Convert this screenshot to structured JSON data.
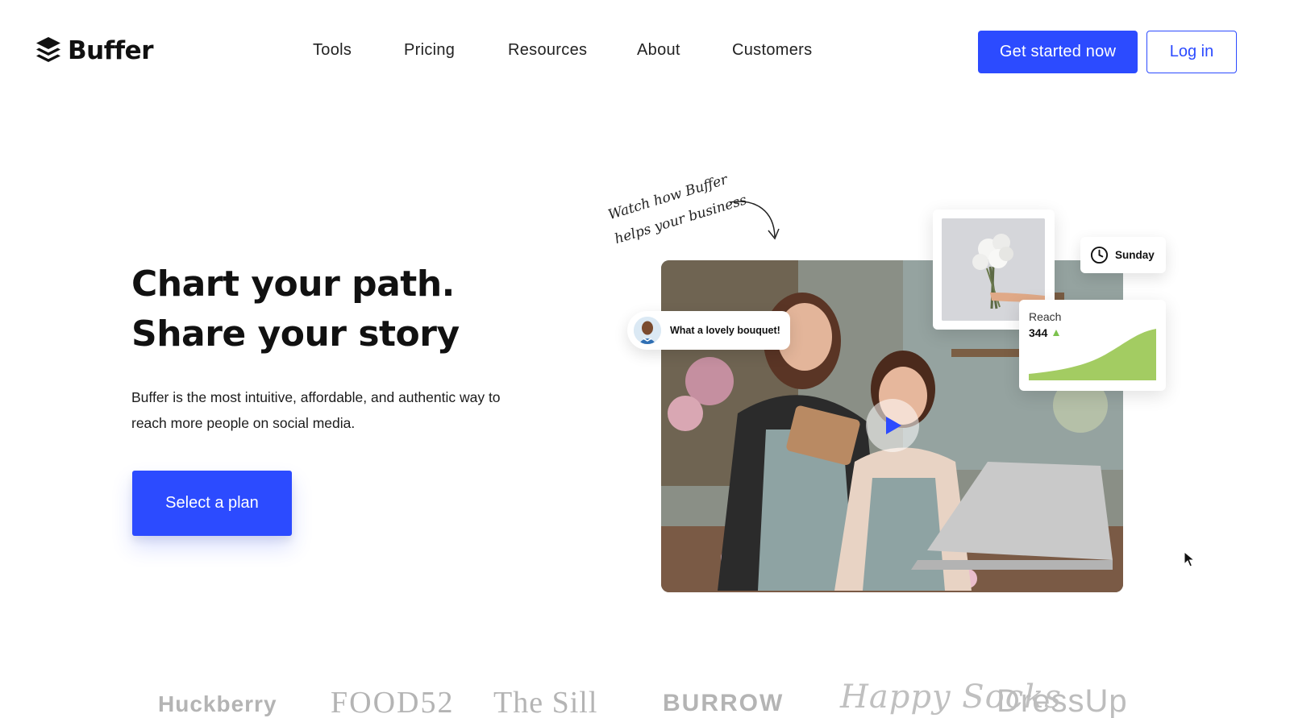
{
  "header": {
    "logo_text": "Buffer",
    "nav": [
      "Tools",
      "Pricing",
      "Resources",
      "About",
      "Customers"
    ],
    "cta_label": "Get started now",
    "login_label": "Log in"
  },
  "hero": {
    "headline_1": "Chart your path.",
    "headline_2": "Share your story",
    "subtext": "Buffer is the most intuitive, affordable, and authentic way to reach more people on social media.",
    "cta_label": "Select a plan"
  },
  "visual": {
    "annotation_1": "Watch how Buffer",
    "annotation_2": "helps your business",
    "comment": "What a lovely bouquet!",
    "day": "Sunday",
    "reach_label": "Reach",
    "reach_value": "344",
    "reach_trend": "up"
  },
  "brands": [
    "Huckberry",
    "FOOD52",
    "The Sill",
    "BURROW",
    "Happy Socks",
    "DressUp"
  ],
  "colors": {
    "brand_blue": "#2c4bff",
    "reach_green": "#a3cc62",
    "text_dark": "#111111",
    "logo_gray": "#b4b4b4"
  },
  "icons": [
    "buffer-logo-icon",
    "play-icon",
    "clock-icon",
    "trend-up-icon",
    "mouse-cursor-icon"
  ]
}
